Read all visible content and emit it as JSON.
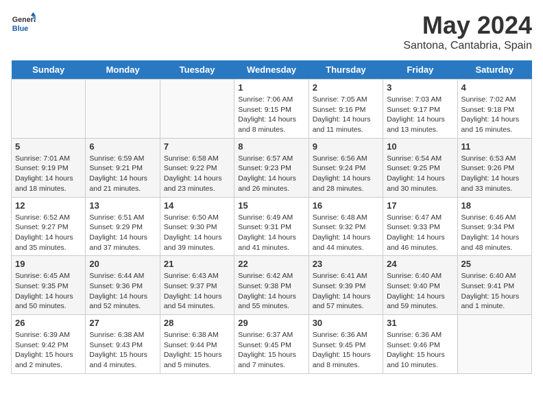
{
  "header": {
    "logo_general": "General",
    "logo_blue": "Blue",
    "month_title": "May 2024",
    "location": "Santona, Cantabria, Spain"
  },
  "days_of_week": [
    "Sunday",
    "Monday",
    "Tuesday",
    "Wednesday",
    "Thursday",
    "Friday",
    "Saturday"
  ],
  "weeks": [
    [
      {
        "day": "",
        "content": ""
      },
      {
        "day": "",
        "content": ""
      },
      {
        "day": "",
        "content": ""
      },
      {
        "day": "1",
        "content": "Sunrise: 7:06 AM\nSunset: 9:15 PM\nDaylight: 14 hours\nand 8 minutes."
      },
      {
        "day": "2",
        "content": "Sunrise: 7:05 AM\nSunset: 9:16 PM\nDaylight: 14 hours\nand 11 minutes."
      },
      {
        "day": "3",
        "content": "Sunrise: 7:03 AM\nSunset: 9:17 PM\nDaylight: 14 hours\nand 13 minutes."
      },
      {
        "day": "4",
        "content": "Sunrise: 7:02 AM\nSunset: 9:18 PM\nDaylight: 14 hours\nand 16 minutes."
      }
    ],
    [
      {
        "day": "5",
        "content": "Sunrise: 7:01 AM\nSunset: 9:19 PM\nDaylight: 14 hours\nand 18 minutes."
      },
      {
        "day": "6",
        "content": "Sunrise: 6:59 AM\nSunset: 9:21 PM\nDaylight: 14 hours\nand 21 minutes."
      },
      {
        "day": "7",
        "content": "Sunrise: 6:58 AM\nSunset: 9:22 PM\nDaylight: 14 hours\nand 23 minutes."
      },
      {
        "day": "8",
        "content": "Sunrise: 6:57 AM\nSunset: 9:23 PM\nDaylight: 14 hours\nand 26 minutes."
      },
      {
        "day": "9",
        "content": "Sunrise: 6:56 AM\nSunset: 9:24 PM\nDaylight: 14 hours\nand 28 minutes."
      },
      {
        "day": "10",
        "content": "Sunrise: 6:54 AM\nSunset: 9:25 PM\nDaylight: 14 hours\nand 30 minutes."
      },
      {
        "day": "11",
        "content": "Sunrise: 6:53 AM\nSunset: 9:26 PM\nDaylight: 14 hours\nand 33 minutes."
      }
    ],
    [
      {
        "day": "12",
        "content": "Sunrise: 6:52 AM\nSunset: 9:27 PM\nDaylight: 14 hours\nand 35 minutes."
      },
      {
        "day": "13",
        "content": "Sunrise: 6:51 AM\nSunset: 9:29 PM\nDaylight: 14 hours\nand 37 minutes."
      },
      {
        "day": "14",
        "content": "Sunrise: 6:50 AM\nSunset: 9:30 PM\nDaylight: 14 hours\nand 39 minutes."
      },
      {
        "day": "15",
        "content": "Sunrise: 6:49 AM\nSunset: 9:31 PM\nDaylight: 14 hours\nand 41 minutes."
      },
      {
        "day": "16",
        "content": "Sunrise: 6:48 AM\nSunset: 9:32 PM\nDaylight: 14 hours\nand 44 minutes."
      },
      {
        "day": "17",
        "content": "Sunrise: 6:47 AM\nSunset: 9:33 PM\nDaylight: 14 hours\nand 46 minutes."
      },
      {
        "day": "18",
        "content": "Sunrise: 6:46 AM\nSunset: 9:34 PM\nDaylight: 14 hours\nand 48 minutes."
      }
    ],
    [
      {
        "day": "19",
        "content": "Sunrise: 6:45 AM\nSunset: 9:35 PM\nDaylight: 14 hours\nand 50 minutes."
      },
      {
        "day": "20",
        "content": "Sunrise: 6:44 AM\nSunset: 9:36 PM\nDaylight: 14 hours\nand 52 minutes."
      },
      {
        "day": "21",
        "content": "Sunrise: 6:43 AM\nSunset: 9:37 PM\nDaylight: 14 hours\nand 54 minutes."
      },
      {
        "day": "22",
        "content": "Sunrise: 6:42 AM\nSunset: 9:38 PM\nDaylight: 14 hours\nand 55 minutes."
      },
      {
        "day": "23",
        "content": "Sunrise: 6:41 AM\nSunset: 9:39 PM\nDaylight: 14 hours\nand 57 minutes."
      },
      {
        "day": "24",
        "content": "Sunrise: 6:40 AM\nSunset: 9:40 PM\nDaylight: 14 hours\nand 59 minutes."
      },
      {
        "day": "25",
        "content": "Sunrise: 6:40 AM\nSunset: 9:41 PM\nDaylight: 15 hours\nand 1 minute."
      }
    ],
    [
      {
        "day": "26",
        "content": "Sunrise: 6:39 AM\nSunset: 9:42 PM\nDaylight: 15 hours\nand 2 minutes."
      },
      {
        "day": "27",
        "content": "Sunrise: 6:38 AM\nSunset: 9:43 PM\nDaylight: 15 hours\nand 4 minutes."
      },
      {
        "day": "28",
        "content": "Sunrise: 6:38 AM\nSunset: 9:44 PM\nDaylight: 15 hours\nand 5 minutes."
      },
      {
        "day": "29",
        "content": "Sunrise: 6:37 AM\nSunset: 9:45 PM\nDaylight: 15 hours\nand 7 minutes."
      },
      {
        "day": "30",
        "content": "Sunrise: 6:36 AM\nSunset: 9:45 PM\nDaylight: 15 hours\nand 8 minutes."
      },
      {
        "day": "31",
        "content": "Sunrise: 6:36 AM\nSunset: 9:46 PM\nDaylight: 15 hours\nand 10 minutes."
      },
      {
        "day": "",
        "content": ""
      }
    ]
  ]
}
